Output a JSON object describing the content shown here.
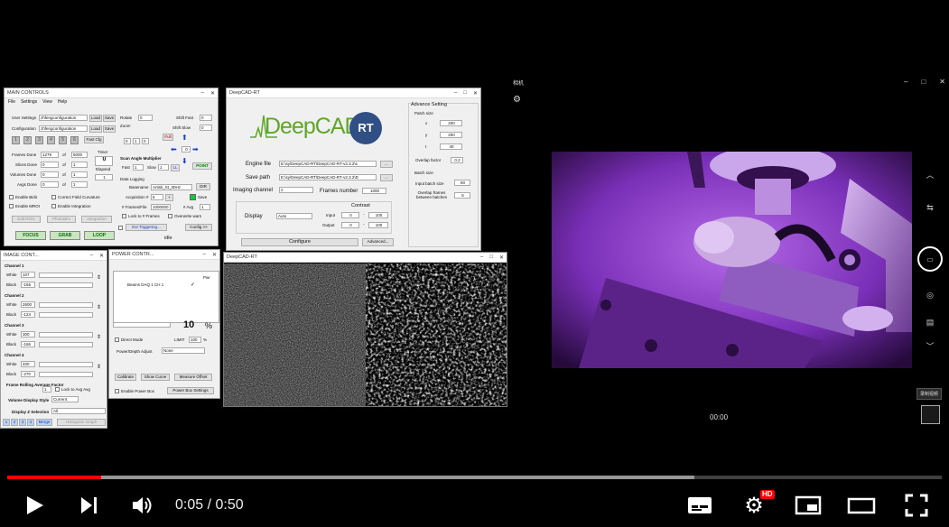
{
  "main_controls": {
    "title": "MAIN CONTROLS",
    "menu": [
      "File",
      "Settings",
      "View",
      "Help"
    ],
    "user_settings_label": "User Settings",
    "user_settings_value": "zhfengconfiguration",
    "configuration_label": "Configuration",
    "configuration_value": "zhfengconfiguration",
    "load": "Load",
    "save": "Save",
    "numbers": [
      "1",
      "2",
      "3",
      "4",
      "5",
      "6"
    ],
    "fast_cfg": "Fast Cfg",
    "rotate_label": "Rotate",
    "rotate_value": "0",
    "zoom_label": "Zoom",
    "shift_fast_label": "Shift Fast",
    "shift_fast_value": "0",
    "shift_slow_label": "Shift Slow",
    "shift_slow_value": "0",
    "full": "Full",
    "point": "POINT",
    "zoom_digits": [
      "0",
      "1",
      "0"
    ],
    "frames_done_label": "Frames Done",
    "frames_done_value": "1279",
    "of": "of",
    "frames_total": "5000",
    "slices_done_label": "Slices Done",
    "slices_done_value": "0",
    "slices_total": "1",
    "volumes_done_label": "Volumes Done",
    "volumes_done_value": "0",
    "volumes_total": "1",
    "avgs_done_label": "Avgs Done",
    "avgs_done_value": "0",
    "avgs_total": "1",
    "timer_label": "Timer",
    "timer_value": "0",
    "elapsed_label": "Elapsed",
    "timer_extra": "1",
    "scan_angle_label": "Scan Angle Multiplier",
    "fast_label": "Fast",
    "fast_value": "1",
    "slow_label": "Slow",
    "slow_value": "1",
    "ll": "LL",
    "data_logging_label": "Data Logging",
    "basename_label": "Basename",
    "basename_value": "Artisk_St_30Hz",
    "dir": "DIR",
    "acquisition_label": "Acquisition #",
    "acquisition_value": "5",
    "frames_file_label": "# Frames/File",
    "frames_file_value": "1000000",
    "avg_label": "# Avg",
    "avg_value": "1",
    "save_check": "Save",
    "lock_frames": "Lock to # Frames",
    "overwrite_warn": "Overwrite warn",
    "enable_bidir": "Enable Bidir",
    "correct_field": "Correct Field Curvature",
    "enable_mroi": "Enable MROI",
    "enable_integration": "Enable Integration",
    "edit_rois": "Edit ROIs",
    "photostim": "Photostim",
    "integration": "Integration",
    "ext_triggering": "Ext Triggering...",
    "config_btn": "Config >>",
    "focus": "FOCUS",
    "grab": "GRAB",
    "loop": "LOOP",
    "status": "idle"
  },
  "deepcad": {
    "title": "DeepCAD-RT",
    "logo": "DeepCAD",
    "logo_rt": "RT",
    "engine_file_label": "Engine file",
    "engine_file_value": "E:\\sy\\DeepCAD-RT\\DeepCAD-RT-v2.3.2\\s",
    "save_path_label": "Save path",
    "save_path_value": "E:\\sy\\DeepCAD-RT\\DeepCAD-RT-v2.3.2\\D",
    "imaging_channel_label": "Imaging channel",
    "imaging_channel_value": "2",
    "frames_number_label": "Frames number",
    "frames_number_value": "1000",
    "display_label": "Display",
    "display_value": "Auto",
    "contrast_label": "Contrast",
    "input_label": "Input",
    "output_label": "Output",
    "contrast_min": "0",
    "contrast_max": "100",
    "configure": "Configure",
    "advanced": "Advanced...",
    "adv_setting_label": "Advance Setting",
    "patch_size_label": "Patch size",
    "patch_x_label": "x",
    "patch_x": "200",
    "patch_y_label": "y",
    "patch_y": "200",
    "patch_t_label": "t",
    "patch_t": "40",
    "overlap_label": "Overlap factor",
    "overlap_value": "0.2",
    "batch_size_label": "Batch size",
    "input_batch_label": "Input batch size",
    "input_batch_value": "60",
    "overlap_frames_label": "Overlap frames between batches",
    "overlap_frames_value": "5"
  },
  "image_controls": {
    "title": "IMAGE CONT...",
    "channels": [
      {
        "name": "Channel 1",
        "white": "107",
        "black": "-165"
      },
      {
        "name": "Channel 2",
        "white": "2600",
        "black": "-124"
      },
      {
        "name": "Channel 3",
        "white": "300",
        "black": "-166"
      },
      {
        "name": "Channel 4",
        "white": "400",
        "black": "-270"
      }
    ],
    "white_label": "White",
    "black_label": "Black",
    "rolling_label": "Frame Rolling Average Factor",
    "rolling_value": "1",
    "lock_avg": "Lock to Avg Avg",
    "volume_style_label": "Volume Display Style",
    "volume_style_value": "Current",
    "z_selection_label": "Display Z Selection",
    "z_selection_value": "All",
    "tabs": [
      "1",
      "2",
      "3",
      "4"
    ],
    "merge": "Merge",
    "histogram": "Histogram Graph"
  },
  "power_controls": {
    "title": "POWER CONTR...",
    "col_header": "Pwr",
    "beam": "Beams DAQ 1 CH 1",
    "percent_value": "10",
    "percent_sign": "%",
    "direct_mode": "Direct Mode",
    "limit_label": "LIMIT",
    "limit_value": "100",
    "limit_unit": "%",
    "power_depth_label": "Power/Depth Adjust",
    "power_depth_value": "None",
    "calibrate": "Calibrate",
    "show_curve": "Show Curve",
    "measure_offset": "Measure Offset",
    "enable_power_box": "Enable Power Box",
    "power_box_settings": "Power Box Settings"
  },
  "deepcad_view": {
    "title": "DeepCAD-RT"
  },
  "camera": {
    "title": "相机",
    "time": "00:00",
    "record_tooltip": "录制视频"
  },
  "player": {
    "time_current": "0:05",
    "time_sep": " / ",
    "time_total": "0:50",
    "hd_badge": "HD",
    "progress_fraction": 0.1,
    "buffer_fraction": 0.735,
    "colors": {
      "progress": "#ff0000",
      "camera_purple": "#9b3fd6"
    }
  }
}
